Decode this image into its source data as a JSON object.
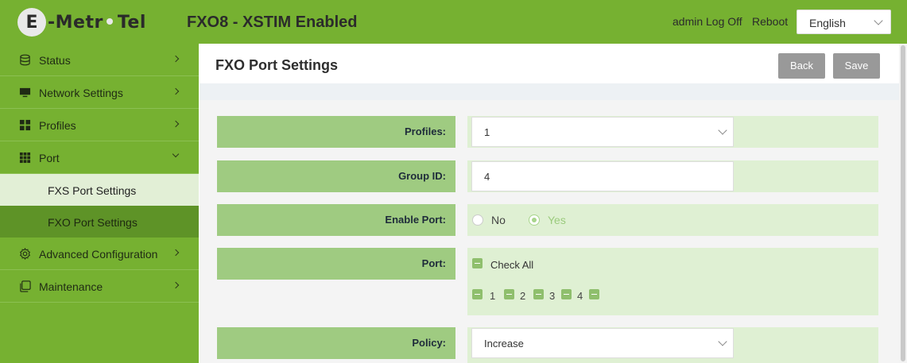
{
  "header": {
    "logo_e": "E",
    "logo_left": "-Metr",
    "logo_right": "Tel",
    "title": "FXO8 - XSTIM Enabled",
    "admin_label": "admin",
    "logoff_label": "Log Off",
    "reboot_label": "Reboot",
    "language": "English",
    "brand_color": "#76b131"
  },
  "sidebar": {
    "items": [
      {
        "label": "Status",
        "icon": "database-icon"
      },
      {
        "label": "Network Settings",
        "icon": "monitor-icon"
      },
      {
        "label": "Profiles",
        "icon": "grid-icon"
      },
      {
        "label": "Port",
        "icon": "apps-icon"
      },
      {
        "label": "Advanced Configuration",
        "icon": "gear-icon"
      },
      {
        "label": "Maintenance",
        "icon": "copy-icon"
      }
    ],
    "sub_items": [
      {
        "label": "FXS Port Settings"
      },
      {
        "label": "FXO Port Settings"
      }
    ]
  },
  "main": {
    "title": "FXO Port Settings",
    "back_label": "Back",
    "save_label": "Save",
    "fields": {
      "profiles": {
        "label": "Profiles:",
        "value": "1"
      },
      "group_id": {
        "label": "Group ID:",
        "value": "4"
      },
      "enable_port": {
        "label": "Enable Port:",
        "options": [
          "No",
          "Yes"
        ],
        "selected": "Yes"
      },
      "port": {
        "label": "Port:",
        "check_all": "Check All",
        "ports": [
          "1",
          "2",
          "3",
          "4"
        ]
      },
      "policy": {
        "label": "Policy:",
        "value": "Increase"
      }
    }
  }
}
